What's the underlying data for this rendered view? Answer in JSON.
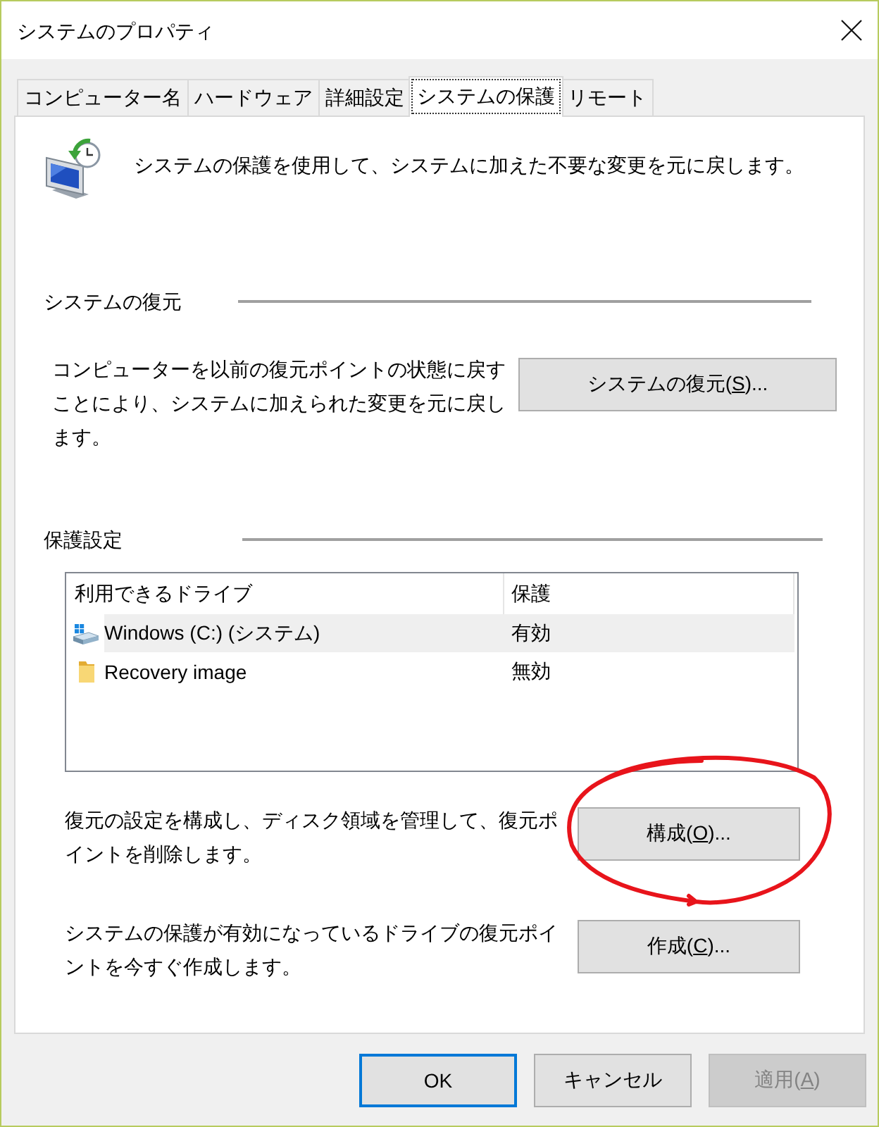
{
  "window": {
    "title": "システムのプロパティ"
  },
  "tabs": [
    {
      "label": "コンピューター名",
      "selected": false
    },
    {
      "label": "ハードウェア",
      "selected": false
    },
    {
      "label": "詳細設定",
      "selected": false
    },
    {
      "label": "システムの保護",
      "selected": true
    },
    {
      "label": "リモート",
      "selected": false
    }
  ],
  "intro": {
    "text": "システムの保護を使用して、システムに加えた不要な変更を元に戻します。"
  },
  "system_restore": {
    "heading": "システムの復元",
    "description": "コンピューターを以前の復元ポイントの状態に戻すことにより、システムに加えられた変更を元に戻します。",
    "button": {
      "label": "システムの復元(",
      "access_key": "S",
      "label_after": ")..."
    }
  },
  "protection_settings": {
    "heading": "保護設定",
    "columns": [
      "利用できるドライブ",
      "保護"
    ],
    "drives": [
      {
        "kind": "system_drive",
        "name": "Windows (C:) (システム)",
        "protection": "有効",
        "selected": true
      },
      {
        "kind": "folder",
        "name": "Recovery image",
        "protection": "無効",
        "selected": false
      }
    ],
    "actions": [
      {
        "description": "復元の設定を構成し、ディスク領域を管理して、復元ポイントを削除します。",
        "button": {
          "label": "構成(",
          "access_key": "O",
          "label_after": ")..."
        },
        "circled": true
      },
      {
        "description": "システムの保護が有効になっているドライブの復元ポイントを今すぐ作成します。",
        "button": {
          "label": "作成(",
          "access_key": "C",
          "label_after": ")..."
        },
        "circled": false
      }
    ]
  },
  "dialog_buttons": [
    {
      "label": "OK",
      "default": true,
      "disabled": false
    },
    {
      "label": "キャンセル",
      "default": false,
      "disabled": false
    },
    {
      "label": "適用(",
      "access_key": "A",
      "label_after": ")",
      "default": false,
      "disabled": true
    }
  ]
}
